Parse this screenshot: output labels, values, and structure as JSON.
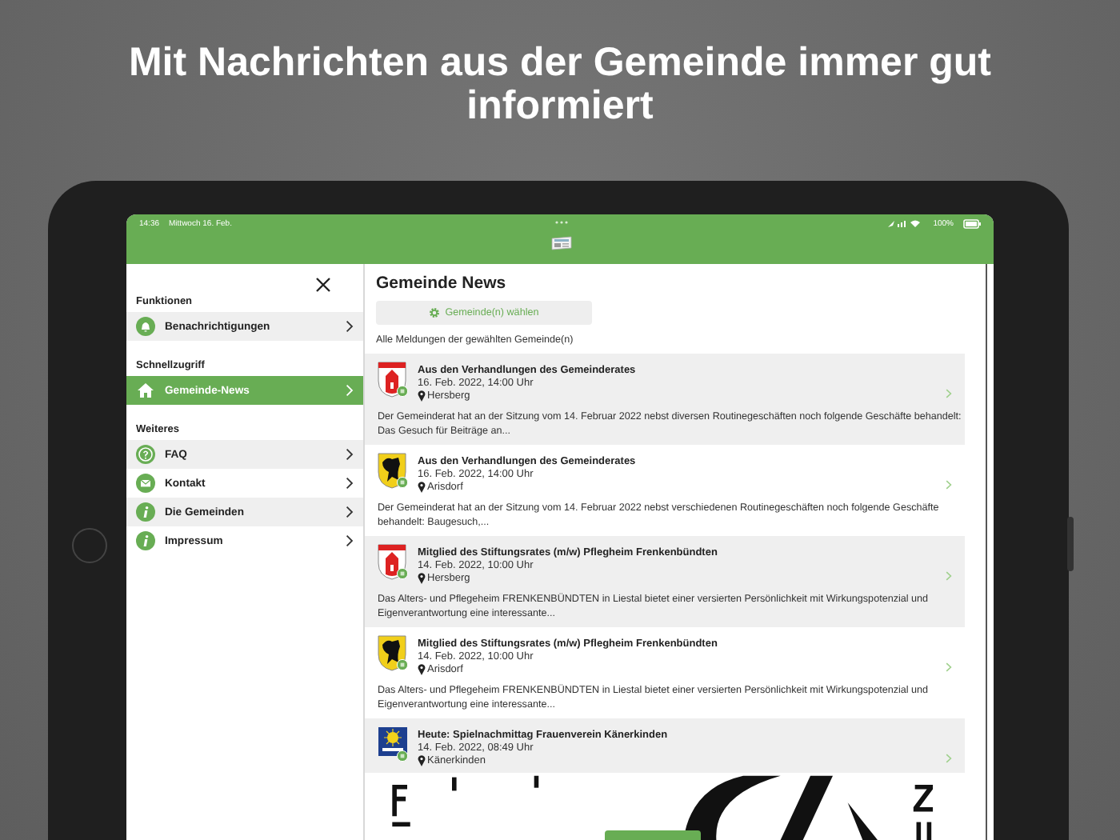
{
  "headline": "Mit Nachrichten aus der Gemeinde immer gut informiert",
  "status_bar": {
    "time": "14:36",
    "date": "Mittwoch 16. Feb.",
    "battery": "100%"
  },
  "sidebar": {
    "sections": [
      {
        "title": "Funktionen",
        "items": [
          {
            "label": "Benachrichtigungen",
            "selected": false
          }
        ]
      },
      {
        "title": "Schnellzugriff",
        "items": [
          {
            "label": "Gemeinde-News",
            "selected": true
          }
        ]
      },
      {
        "title": "Weiteres",
        "items": [
          {
            "label": "FAQ",
            "selected": false
          },
          {
            "label": "Kontakt",
            "selected": false
          },
          {
            "label": "Die Gemeinden",
            "selected": false
          },
          {
            "label": "Impressum",
            "selected": false
          }
        ]
      }
    ]
  },
  "main": {
    "title": "Gemeinde News",
    "choose_button": "Gemeinde(n) wählen",
    "subtitle": "Alle Meldungen der gewählten Gemeinde(n)",
    "news": [
      {
        "title": "Aus den Verhandlungen des Gemeinderates",
        "date": "16. Feb. 2022, 14:00 Uhr",
        "place": "Hersberg",
        "text": "Der Gemeinderat hat an der Sitzung vom 14. Februar 2022 nebst diversen Routinegeschäften noch folgende Geschäfte behandelt: Das Gesuch für Beiträge an..."
      },
      {
        "title": "Aus den Verhandlungen des Gemeinderates",
        "date": "16. Feb. 2022, 14:00 Uhr",
        "place": "Arisdorf",
        "text": "Der Gemeinderat hat an der Sitzung vom 14. Februar 2022 nebst verschiedenen Routinegeschäften noch folgende Geschäfte behandelt:   Baugesuch,..."
      },
      {
        "title": "Mitglied des Stiftungsrates (m/w) Pflegheim Frenkenbündten",
        "date": "14. Feb. 2022, 10:00 Uhr",
        "place": "Hersberg",
        "text": "Das Alters- und Pflegeheim FRENKENBÜNDTEN in Liestal bietet einer versierten Persönlichkeit mit Wirkungspotenzial und Eigenverantwortung eine interessante..."
      },
      {
        "title": "Mitglied des Stiftungsrates (m/w) Pflegheim Frenkenbündten",
        "date": "14. Feb. 2022, 10:00 Uhr",
        "place": "Arisdorf",
        "text": "Das Alters- und Pflegeheim FRENKENBÜNDTEN in Liestal bietet einer versierten Persönlichkeit mit Wirkungspotenzial und Eigenverantwortung eine interessante..."
      },
      {
        "title": "Heute: Spielnachmittag Frauenverein Känerkinden",
        "date": "14. Feb. 2022, 08:49 Uhr",
        "place": "Känerkinden"
      }
    ]
  }
}
